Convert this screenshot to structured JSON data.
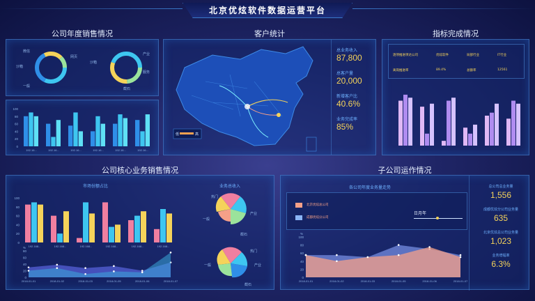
{
  "header": {
    "title": "北京优炫软件数据运营平台"
  },
  "sections": {
    "annual_sales": "公司年度销售情况",
    "customers": "客户统计",
    "target": "指标完成情况",
    "core_sales": "公司核心业务销售情况",
    "subsidiary": "子公司运作情况"
  },
  "donuts": {
    "labels_left": [
      "微信",
      "网页",
      "沙箱",
      "一般"
    ],
    "labels_right": [
      "沙箱",
      "产业",
      "服务",
      "截石"
    ]
  },
  "annual_bars": {
    "y_ticks": [
      "100",
      "80",
      "60",
      "40",
      "20",
      "0"
    ],
    "x_ticks": [
      "192.16...",
      "192.16...",
      "192.16...",
      "192.16...",
      "192.16...",
      "192.16..."
    ],
    "values": [
      [
        80,
        90,
        80
      ],
      [
        60,
        25,
        70
      ],
      [
        55,
        90,
        40
      ],
      [
        40,
        80,
        60
      ],
      [
        60,
        85,
        75
      ],
      [
        70,
        40,
        85
      ]
    ]
  },
  "map": {
    "legend_low": "低",
    "legend_high": "高",
    "stats": [
      {
        "label": "总业务收入",
        "value": "87,800"
      },
      {
        "label": "总客户量",
        "value": "20,000"
      },
      {
        "label": "新增客户比",
        "value": "40.6%"
      },
      {
        "label": "业务完成率",
        "value": "85%"
      }
    ]
  },
  "target_table": {
    "rows": [
      [
        "逐项推进项达公司",
        "优炫软件",
        "局部行业",
        "IT行业"
      ],
      [
        "离岗推进率",
        "89.4%",
        "总额率",
        "12561"
      ]
    ],
    "bars": [
      [
        75,
        85,
        80
      ],
      [
        65,
        20,
        70
      ],
      [
        8,
        75,
        80
      ],
      [
        30,
        20,
        35
      ],
      [
        50,
        55,
        70
      ],
      [
        45,
        75,
        70
      ]
    ]
  },
  "core": {
    "market_title": "市场份额占比",
    "revenue_title": "业务总收入",
    "y_ticks": [
      "100",
      "80",
      "60",
      "40",
      "20",
      "0"
    ],
    "x_ticks": [
      "192.168...",
      "192.168...",
      "192.168...",
      "192.168...",
      "192.168...",
      "192.168..."
    ],
    "bars": [
      [
        85,
        90,
        85
      ],
      [
        60,
        20,
        70
      ],
      [
        10,
        90,
        65
      ],
      [
        90,
        35,
        40
      ],
      [
        50,
        60,
        70
      ],
      [
        30,
        75,
        65
      ]
    ],
    "line_unit": "%",
    "line_y_ticks": [
      "80",
      "60",
      "40",
      "20",
      "0"
    ],
    "line_x_ticks": [
      "2018-01-01",
      "2018-01-02",
      "2018-01-03",
      "2018-01-05",
      "2018-01-06",
      "2018-01-07"
    ],
    "series_a": [
      20,
      28,
      10,
      18,
      15,
      75
    ],
    "series_b": [
      30,
      38,
      28,
      34,
      20,
      45
    ],
    "rose_labels_top": [
      "热门",
      "产业",
      "截石",
      "一般"
    ],
    "rose_labels_bottom": [
      "热门",
      "产业",
      "截石",
      "一般"
    ]
  },
  "subsidiary": {
    "chart_title": "各公司年度业务量走势",
    "legend_a": "北京优炫总公司",
    "legend_b": "成都优炫分公司",
    "slider_label": "日月年",
    "y_unit": "%",
    "y_ticks": [
      "100",
      "80",
      "60",
      "40",
      "20",
      "0"
    ],
    "x_ticks": [
      "2018-01-01",
      "2018-01-02",
      "2018-01-03",
      "2018-01-05",
      "2018-01-06",
      "2018-01-07"
    ],
    "series_a": [
      55,
      40,
      50,
      55,
      75,
      50
    ],
    "series_b": [
      55,
      55,
      50,
      80,
      70,
      55
    ],
    "stats": [
      {
        "label": "总公司总业务量",
        "value": "1,556"
      },
      {
        "label": "成都优炫分公司业务量",
        "value": "635"
      },
      {
        "label": "北京优炫总公司业务量",
        "value": "1,023"
      },
      {
        "label": "业务增幅率",
        "value": "6.3%"
      }
    ]
  },
  "colors": {
    "cyan": "#3ec6f0",
    "blue": "#2f8fe8",
    "pink": "#f07fa0",
    "yellow": "#f5d35a",
    "violet": "#b08cf0",
    "lilac": "#e0b8f5",
    "green": "#9be39b",
    "peach": "#f5a088"
  }
}
